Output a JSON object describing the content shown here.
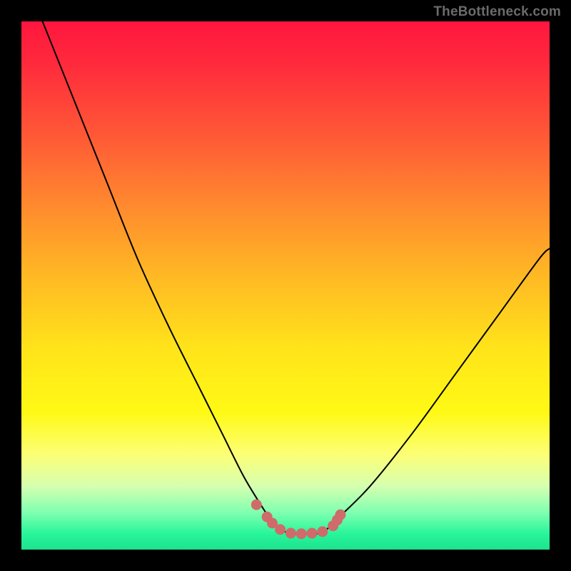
{
  "watermark": "TheBottleneck.com",
  "chart_data": {
    "type": "line",
    "title": "",
    "xlabel": "",
    "ylabel": "",
    "xlim": [
      0,
      100
    ],
    "ylim": [
      0,
      100
    ],
    "series": [
      {
        "name": "curve",
        "x": [
          4,
          10,
          16,
          22,
          28,
          34,
          38,
          42,
          45,
          47,
          49,
          51,
          54,
          56,
          58,
          60,
          66,
          74,
          82,
          90,
          98,
          100
        ],
        "values": [
          100,
          85,
          70,
          55,
          42,
          30,
          22,
          14,
          9,
          6,
          4,
          3,
          3,
          3,
          4,
          6,
          12,
          22,
          33,
          44,
          55,
          57
        ]
      }
    ],
    "markers": {
      "name": "marker-dots",
      "x": [
        44.5,
        46.5,
        47.5,
        49.0,
        51.0,
        53.0,
        55.0,
        57.0,
        59.0,
        59.8,
        60.4
      ],
      "values": [
        8.5,
        6.2,
        5.0,
        3.8,
        3.1,
        3.0,
        3.1,
        3.4,
        4.5,
        5.6,
        6.6
      ]
    }
  }
}
